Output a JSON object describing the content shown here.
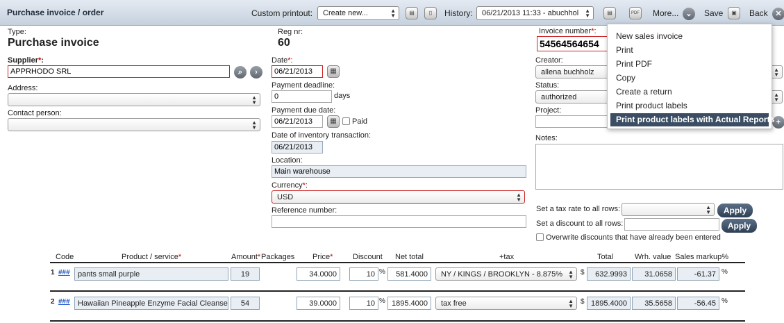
{
  "topbar": {
    "title": "Purchase invoice / order",
    "custom_printout_label": "Custom printout:",
    "custom_printout_value": "Create new...",
    "history_label": "History:",
    "history_value": "06/21/2013 11:33 - abuchhol",
    "more_label": "More...",
    "save_label": "Save",
    "back_label": "Back",
    "pdf_icon_text": "PDF"
  },
  "form": {
    "type_label": "Type:",
    "type_value": "Purchase invoice",
    "regnr_label": "Reg nr:",
    "regnr_value": "60",
    "invoice_number_label": "Invoice number",
    "invoice_number_value": "54564564654",
    "supplier_label": "Supplier",
    "supplier_value": "APPRHODO SRL",
    "address_label": "Address:",
    "contact_label": "Contact person:",
    "date_label": "Date",
    "date_value": "06/21/2013",
    "payment_deadline_label": "Payment deadline:",
    "payment_deadline_value": "0",
    "days_label": "days",
    "payment_due_label": "Payment due date:",
    "payment_due_value": "06/21/2013",
    "paid_label": "Paid",
    "inventory_date_label": "Date of inventory transaction:",
    "inventory_date_value": "06/21/2013",
    "location_label": "Location:",
    "location_value": "Main warehouse",
    "currency_label": "Currency",
    "currency_value": "USD",
    "reference_label": "Reference number:",
    "creator_label": "Creator:",
    "creator_value": "allena buchholz",
    "status_label": "Status:",
    "status_value": "authorized",
    "project_label": "Project:",
    "notes_label": "Notes:",
    "tax_rate_label": "Set a tax rate to all rows:",
    "discount_label": "Set a discount to all rows:",
    "apply_label": "Apply",
    "overwrite_label": "Overwrite discounts that have already been entered",
    "required_mark": "*",
    "colon": ":"
  },
  "menu": {
    "items": [
      "New sales invoice",
      "Print",
      "Print PDF",
      "Copy",
      "Create a return",
      "Print product labels",
      "Print product labels with Actual Reports"
    ],
    "highlighted_index": 6
  },
  "table": {
    "headers": {
      "code": "Code",
      "product": "Product / service",
      "amount": "Amount",
      "packages": "Packages",
      "price": "Price",
      "discount": "Discount",
      "net_total": "Net total",
      "tax": "+tax",
      "total": "Total",
      "wrh_value": "Wrh. value",
      "sales_markup": "Sales markup%"
    },
    "rows": [
      {
        "num": "1",
        "code": "###",
        "product": "pants small purple",
        "amount": "19",
        "price": "34.0000",
        "discount": "10",
        "net_total": "581.4000",
        "tax": "NY / KINGS / BROOKLYN - 8.875%",
        "total": "632.9993",
        "wrh_value": "31.0658",
        "sales_markup": "-61.37"
      },
      {
        "num": "2",
        "code": "###",
        "product": "Hawaiian Pineapple Enzyme Facial Cleanser",
        "amount": "54",
        "price": "39.0000",
        "discount": "10",
        "net_total": "1895.4000",
        "tax": "tax free",
        "total": "1895.4000",
        "wrh_value": "35.5658",
        "sales_markup": "-56.45"
      }
    ],
    "percent_sign": "%",
    "dollar_sign": "$"
  }
}
